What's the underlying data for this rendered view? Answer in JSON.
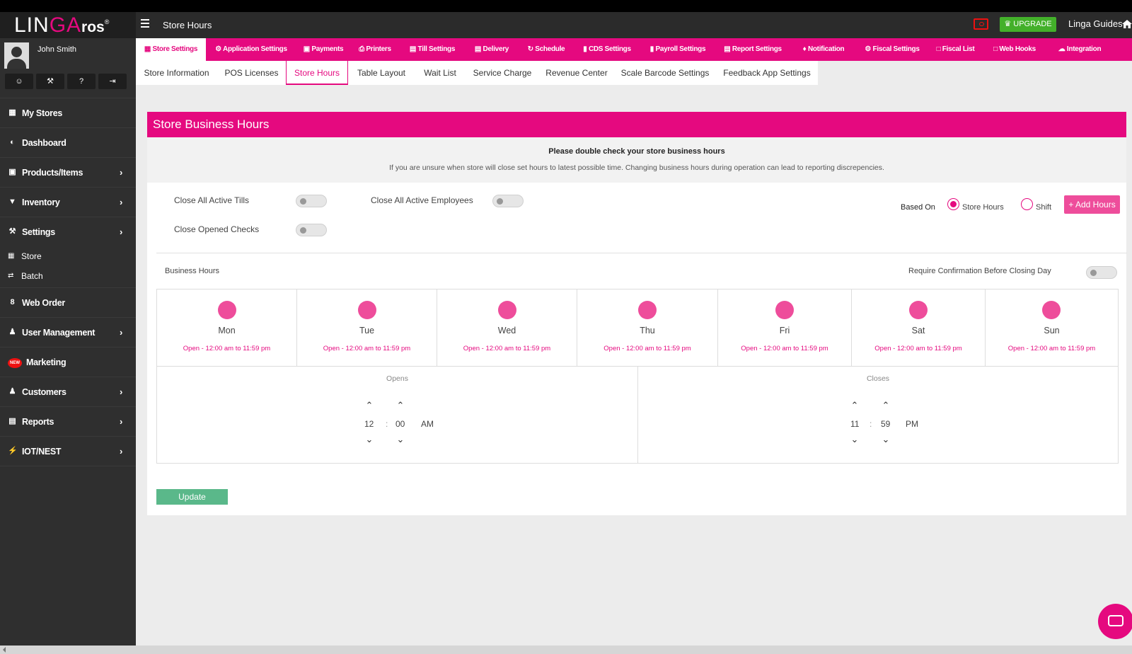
{
  "app": {
    "logo_left": "LIN",
    "logo_mid": "GA",
    "logo_right": "ros",
    "logo_reg": "®",
    "page_title": "Store Hours",
    "upgrade_label": "UPGRADE",
    "guides_label": "Linga Guides"
  },
  "user": {
    "name": "John Smith",
    "buttons": [
      "profile-icon",
      "wrench-icon",
      "help-icon",
      "logout-icon"
    ]
  },
  "sidebar": {
    "items": [
      {
        "label": "My Stores",
        "icon": "store-icon",
        "chevron": false
      },
      {
        "label": "Dashboard",
        "icon": "dashboard-icon",
        "chevron": false
      },
      {
        "label": "Products/Items",
        "icon": "gift-icon",
        "chevron": true
      },
      {
        "label": "Inventory",
        "icon": "basket-icon",
        "chevron": true
      },
      {
        "label": "Settings",
        "icon": "wrench-icon",
        "chevron": true
      },
      {
        "label": "Web Order",
        "icon": "web-order-icon",
        "chevron": false
      },
      {
        "label": "User Management",
        "icon": "users-icon",
        "chevron": true
      },
      {
        "label": "Marketing",
        "icon": "new-badge-icon",
        "chevron": false,
        "badge": "NEW"
      },
      {
        "label": "Customers",
        "icon": "users-icon",
        "chevron": true
      },
      {
        "label": "Reports",
        "icon": "report-icon",
        "chevron": true
      },
      {
        "label": "IOT/NEST",
        "icon": "plug-icon",
        "chevron": true
      }
    ],
    "sub_items": [
      {
        "label": "Store",
        "icon": "store-icon"
      },
      {
        "label": "Batch",
        "icon": "exchange-icon"
      }
    ],
    "chevron": "›"
  },
  "main_tabs": [
    {
      "label": "Store Settings",
      "icon": "store-icon",
      "active": true
    },
    {
      "label": "Application Settings",
      "icon": "gears-icon"
    },
    {
      "label": "Payments",
      "icon": "money-icon"
    },
    {
      "label": "Printers",
      "icon": "printer-icon"
    },
    {
      "label": "Till Settings",
      "icon": "till-icon"
    },
    {
      "label": "Delivery",
      "icon": "delivery-icon"
    },
    {
      "label": "Schedule",
      "icon": "refresh-icon"
    },
    {
      "label": "CDS Settings",
      "icon": "cds-icon"
    },
    {
      "label": "Payroll Settings",
      "icon": "payroll-icon"
    },
    {
      "label": "Report Settings",
      "icon": "report-icon"
    },
    {
      "label": "Notification",
      "icon": "bell-icon"
    },
    {
      "label": "Fiscal Settings",
      "icon": "gears-icon"
    },
    {
      "label": "Fiscal List",
      "icon": "file-icon"
    },
    {
      "label": "Web Hooks",
      "icon": "file-icon"
    },
    {
      "label": "Integration",
      "icon": "cloud-icon"
    }
  ],
  "sub_tabs": [
    {
      "label": "Store Information"
    },
    {
      "label": "POS Licenses"
    },
    {
      "label": "Store Hours",
      "active": true
    },
    {
      "label": "Table Layout"
    },
    {
      "label": "Wait List"
    },
    {
      "label": "Service Charge"
    },
    {
      "label": "Revenue Center"
    },
    {
      "label": "Scale Barcode Settings"
    },
    {
      "label": "Feedback App Settings"
    }
  ],
  "panel": {
    "title": "Store Business Hours",
    "notice_title": "Please double check your store business hours",
    "notice_text": "If you are unsure when store will close set hours to latest possible time. Changing business hours during operation can lead to reporting discrepencies.",
    "close_tills_label": "Close All Active Tills",
    "close_employees_label": "Close All Active Employees",
    "close_checks_label": "Close Opened Checks",
    "close_tills_on": false,
    "close_employees_on": false,
    "close_checks_on": false,
    "based_on_label": "Based On",
    "store_hours_label": "Store Hours",
    "shift_label": "Shift",
    "based_on_selected": "Store Hours",
    "add_hours_label": "+ Add Hours",
    "business_hours_label": "Business Hours",
    "require_confirmation_label": "Require Confirmation Before Closing Day",
    "require_confirmation_on": false,
    "update_label": "Update"
  },
  "days": [
    {
      "name": "Mon",
      "hours": "Open - 12:00 am to 11:59 pm"
    },
    {
      "name": "Tue",
      "hours": "Open - 12:00 am to 11:59 pm"
    },
    {
      "name": "Wed",
      "hours": "Open - 12:00 am to 11:59 pm"
    },
    {
      "name": "Thu",
      "hours": "Open - 12:00 am to 11:59 pm"
    },
    {
      "name": "Fri",
      "hours": "Open - 12:00 am to 11:59 pm"
    },
    {
      "name": "Sat",
      "hours": "Open - 12:00 am to 11:59 pm"
    },
    {
      "name": "Sun",
      "hours": "Open - 12:00 am to 11:59 pm"
    }
  ],
  "opens": {
    "label": "Opens",
    "hour": "12",
    "minute": "00",
    "period": "AM",
    "sep": ":"
  },
  "closes": {
    "label": "Closes",
    "hour": "11",
    "minute": "59",
    "period": "PM",
    "sep": ":"
  },
  "colors": {
    "accent": "#e5097f",
    "update": "#5ab88a",
    "upgrade": "#43b02a"
  }
}
